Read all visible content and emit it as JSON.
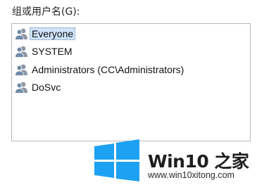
{
  "group_label": "组或用户名(G):",
  "users": [
    {
      "name": "Everyone",
      "selected": true,
      "icon": "user-group-icon"
    },
    {
      "name": "SYSTEM",
      "selected": false,
      "icon": "user-group-icon"
    },
    {
      "name": "Administrators (CC\\Administrators)",
      "selected": false,
      "icon": "user-group-icon"
    },
    {
      "name": "DoSvc",
      "selected": false,
      "icon": "user-group-icon"
    }
  ],
  "watermark": {
    "title": "Win10 之家",
    "url": "www.win10xitong.com",
    "logo_color": "#1da1f2"
  },
  "colors": {
    "selection": "#cfe3fb",
    "list_border": "#b9b9b9"
  }
}
